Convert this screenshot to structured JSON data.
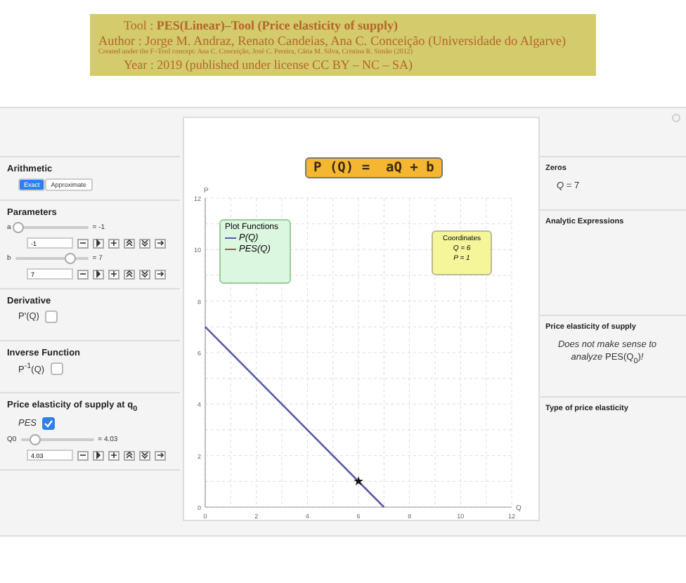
{
  "banner": {
    "lines": [
      "Tool :  **PES(Linear)–Tool (Price elasticity of supply)**",
      "Author :  Jorge M. Andraz, Renato Candeias, Ana C. Conceição (Universidade do Algarve)",
      "Created under the F–Tool concept: Ana C. Conceição, José C. Pereira, Cátia M. Silva, Cristina R. Simão (2012)",
      "Year :  2019  (published under license CC BY – NC – SA)"
    ]
  },
  "left": {
    "arithmetic": {
      "title": "Arithmetic",
      "options": [
        {
          "label": "Exact",
          "selected": true
        },
        {
          "label": "Approximate",
          "selected": false
        }
      ]
    },
    "parameters": {
      "title": "Parameters",
      "sliders": [
        {
          "name": "a",
          "level": 0.05,
          "reading": "= -1",
          "value": "-1"
        },
        {
          "name": "b",
          "level": 0.75,
          "reading": "= 7",
          "value": "7"
        }
      ]
    },
    "derivative": {
      "title": "Derivative",
      "label": "P'(Q)",
      "checked": false
    },
    "inverse": {
      "title": "Inverse Function",
      "label": "P$^{-1}$(Q)",
      "checked": false
    },
    "pes": {
      "title": "Price elasticity of supply at q$_{0}$",
      "label": "PES",
      "checked": true,
      "slider": {
        "name": "Q0",
        "level": 0.2,
        "reading": "= 4.03",
        "value": "4.03"
      }
    }
  },
  "plot": {
    "formula": "P (Q) =  aQ + b",
    "legend": {
      "title": "Plot Functions"
    },
    "coordinates": {
      "title": "Coordinates",
      "lines": [
        "Q = 6",
        "P = 1"
      ]
    },
    "chart_data": {
      "type": "line",
      "xlabel": "Q",
      "ylabel": "P",
      "x": [
        0,
        7
      ],
      "series": [
        {
          "name": "P(Q)",
          "color": "#5a5aa8",
          "values": [
            7,
            0
          ]
        },
        {
          "name": "PES(Q)",
          "color": "#b05050",
          "values": [
            null,
            null
          ]
        }
      ],
      "grid": true,
      "xlim": [
        0,
        12
      ],
      "ylim": [
        0,
        12
      ],
      "xticks": [
        0,
        2,
        4,
        6,
        8,
        10,
        12
      ],
      "yticks": [
        0,
        2,
        4,
        6,
        8,
        10,
        12
      ],
      "annotations": [
        {
          "x": 6,
          "y": 1,
          "text": "★"
        }
      ]
    }
  },
  "right": {
    "sections": [
      {
        "title": "Zeros",
        "text": "*Q* = 7"
      },
      {
        "title": "Analytic Expressions"
      },
      {
        "title": "Price elasticity of supply",
        "text": "*Does not make sense to analyze* PES(Q$_{0}$)*!*"
      },
      {
        "title": "Type of price elasticity"
      }
    ]
  }
}
